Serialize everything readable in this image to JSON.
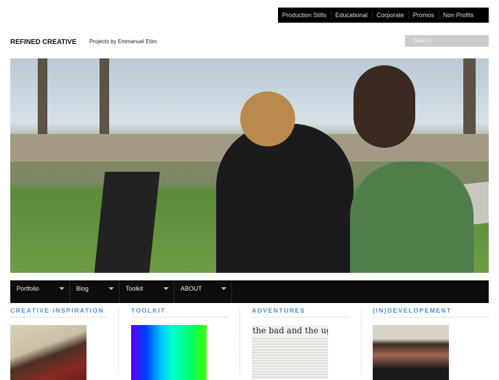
{
  "top_nav": [
    "Production Stills",
    "Educational",
    "Corporate",
    "Promos",
    "Non Profits"
  ],
  "brand": "REFINED CREATIVE",
  "tagline": "Projects by Emmanuel Etim",
  "search": {
    "placeholder": "Search",
    "value": ""
  },
  "main_nav": [
    "Portfolio",
    "Blog",
    "Toolkit",
    "ABOUT"
  ],
  "sections": [
    {
      "title": "CREATIVE INSPIRATION"
    },
    {
      "title": "TOOLKIT"
    },
    {
      "title": "ADVENTURES",
      "thumb_text": "the bad and the ugl"
    },
    {
      "title": "(IN)DEVELOPEMENT"
    }
  ],
  "colors": {
    "accent": "#4b8fe0",
    "nav_bg": "#0d0d0d"
  }
}
